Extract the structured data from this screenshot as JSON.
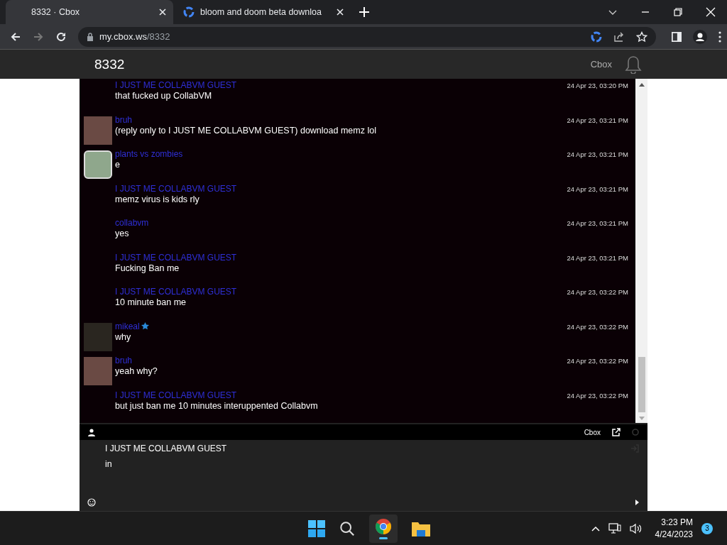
{
  "browser": {
    "tabs": [
      {
        "title": "8332 · Cbox",
        "selected": true,
        "kind": "page"
      },
      {
        "title": "bloom and doom beta downloa",
        "selected": false,
        "kind": "search"
      }
    ],
    "url_host": "my.cbox.ws",
    "url_path": "/8332"
  },
  "header": {
    "title": "8332",
    "link": "Cbox"
  },
  "messages": [
    {
      "name": "I JUST ME COLLABVM GUEST",
      "text": "that fucked up CollabVM",
      "time": "24 Apr 23, 03:20 PM",
      "kind": "guest",
      "verified": false
    },
    {
      "name": "bruh",
      "text": "(reply only to I JUST ME COLLABVM GUEST) download memz lol",
      "time": "24 Apr 23, 03:21 PM",
      "kind": "photo",
      "verified": false
    },
    {
      "name": "plants vs zombies",
      "text": "e",
      "time": "24 Apr 23, 03:21 PM",
      "kind": "cartoon",
      "verified": false
    },
    {
      "name": "I JUST ME COLLABVM GUEST",
      "text": "memz virus is kids rly",
      "time": "24 Apr 23, 03:21 PM",
      "kind": "guest",
      "verified": false
    },
    {
      "name": "collabvm",
      "text": "yes",
      "time": "24 Apr 23, 03:21 PM",
      "kind": "guest",
      "verified": false
    },
    {
      "name": "I JUST ME COLLABVM GUEST",
      "text": "Fucking Ban me",
      "time": "24 Apr 23, 03:21 PM",
      "kind": "guest",
      "verified": false
    },
    {
      "name": "I JUST ME COLLABVM GUEST",
      "text": "10 minute ban me",
      "time": "24 Apr 23, 03:22 PM",
      "kind": "guest",
      "verified": false
    },
    {
      "name": "mikeal",
      "text": "why",
      "time": "24 Apr 23, 03:22 PM",
      "kind": "photo",
      "verified": true
    },
    {
      "name": "bruh",
      "text": "yeah why?",
      "time": "24 Apr 23, 03:22 PM",
      "kind": "photo",
      "verified": false
    },
    {
      "name": "I JUST ME COLLABVM GUEST",
      "text": "but just ban me 10 minutes interuppented Collabvm",
      "time": "24 Apr 23, 03:22 PM",
      "kind": "guest",
      "verified": false
    }
  ],
  "footer_bar": {
    "link": "Cbox"
  },
  "compose": {
    "name": "I JUST ME COLLABVM GUEST",
    "message": "in"
  },
  "taskbar": {
    "time": "3:23 PM",
    "date": "4/24/2023",
    "notifications": "3"
  }
}
